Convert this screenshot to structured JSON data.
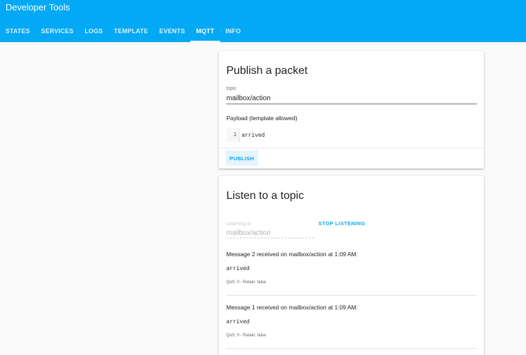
{
  "header": {
    "title": "Developer Tools",
    "background_color": "#03a9f4",
    "tabs": [
      {
        "label": "STATES",
        "active": false
      },
      {
        "label": "SERVICES",
        "active": false
      },
      {
        "label": "LOGS",
        "active": false
      },
      {
        "label": "TEMPLATE",
        "active": false
      },
      {
        "label": "EVENTS",
        "active": false
      },
      {
        "label": "MQTT",
        "active": true
      },
      {
        "label": "INFO",
        "active": false
      }
    ]
  },
  "publish": {
    "title": "Publish a packet",
    "topic_label": "topic",
    "topic_value": "mailbox/action",
    "payload_label": "Payload (template allowed)",
    "payload_line_number": "1",
    "payload_value": "arrived",
    "publish_button": "PUBLISH"
  },
  "listen": {
    "title": "Listen to a topic",
    "listening_label": "Listening to",
    "listening_value": "mailbox/action",
    "stop_button": "STOP LISTENING",
    "messages": [
      {
        "heading": "Message 2 received on mailbox/action at 1:09 AM:",
        "payload": "arrived",
        "meta": "QoS: 0 - Retain: false"
      },
      {
        "heading": "Message 1 received on mailbox/action at 1:09 AM:",
        "payload": "arrived",
        "meta": "QoS: 0 - Retain: false"
      }
    ]
  },
  "colors": {
    "accent": "#03a9f4",
    "background": "#fafafa"
  }
}
